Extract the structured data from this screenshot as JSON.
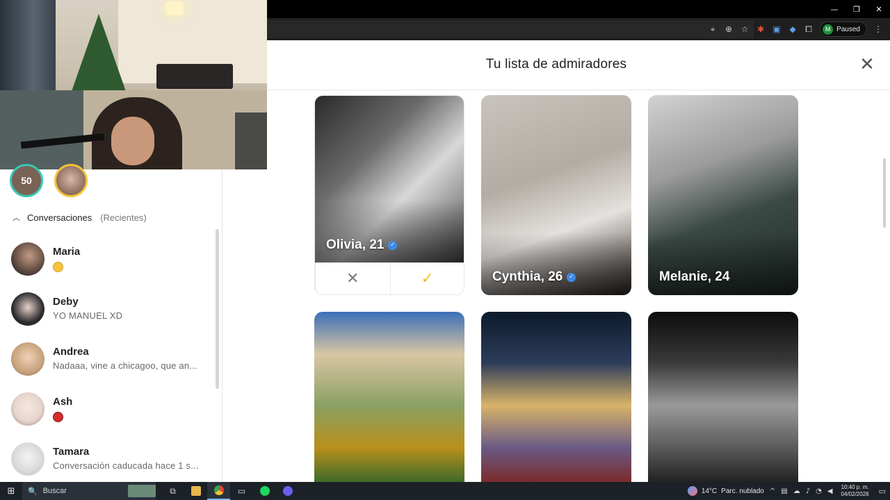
{
  "browser": {
    "window_controls": {
      "minimize": "—",
      "restore": "❐",
      "close": "✕"
    },
    "profile": {
      "initial": "M",
      "status": "Paused"
    },
    "toolbar_icons": [
      "location-icon",
      "zoom-icon",
      "star-icon",
      "extension-red-icon",
      "translate-icon",
      "extension-blue-icon",
      "puzzle-icon"
    ],
    "menu": "⋮"
  },
  "sidebar": {
    "matches": [
      {
        "label": "50"
      },
      {
        "label": ""
      }
    ],
    "conversations_label": "Conversaciones",
    "conversations_sub": "(Recientes)",
    "conversations": [
      {
        "name": "Maria",
        "preview": "",
        "emoji": "yellow",
        "avatar_color": "#4a3a34"
      },
      {
        "name": "Deby",
        "preview": "YO MANUEL XD",
        "emoji": "",
        "avatar_color": "#2a2a2e"
      },
      {
        "name": "Andrea",
        "preview": "Nadaaa, vine a chicagoo, que an...",
        "emoji": "",
        "avatar_color": "#c7a27c"
      },
      {
        "name": "Ash",
        "preview": "",
        "emoji": "red",
        "avatar_color": "#e6d6cf"
      },
      {
        "name": "Tamara",
        "preview": "Conversación caducada hace 1 s...",
        "emoji": "",
        "avatar_color": "#dcdcdc"
      }
    ]
  },
  "panel": {
    "title": "Tu lista de admiradores",
    "close": "✕",
    "cards": [
      {
        "name": "Olivia, 21",
        "verified": true,
        "photo": "ph-olivia"
      },
      {
        "name": "Cynthia, 26",
        "verified": true,
        "photo": "ph-cynthia"
      },
      {
        "name": "Melanie, 24",
        "verified": false,
        "photo": "ph-melanie"
      },
      {
        "name": "",
        "verified": false,
        "photo": "ph-4"
      },
      {
        "name": "",
        "verified": false,
        "photo": "ph-5"
      },
      {
        "name": "",
        "verified": false,
        "photo": "ph-6"
      }
    ],
    "reject": "✕",
    "accept": "✓",
    "verified_mark": "✓"
  },
  "taskbar": {
    "start": "⊞",
    "search_placeholder": "Buscar",
    "search_icon": "🔍",
    "apps": [
      {
        "name": "task-view-icon",
        "glyph": "⧉"
      },
      {
        "name": "file-explorer-icon",
        "glyph": "📁"
      },
      {
        "name": "chrome-icon",
        "glyph": "◉"
      },
      {
        "name": "app-generic-icon",
        "glyph": "▭"
      },
      {
        "name": "spotify-icon",
        "glyph": "●"
      },
      {
        "name": "discord-icon",
        "glyph": "◕"
      }
    ],
    "weather_temp": "14°C",
    "weather_desc": "Parc. nublado",
    "time": "10:40 p. m.",
    "date": "04/02/2026"
  },
  "colors": {
    "accent_teal": "#39c7b2",
    "accent_gold": "#f2c230",
    "verified_blue": "#3d8ef0"
  }
}
